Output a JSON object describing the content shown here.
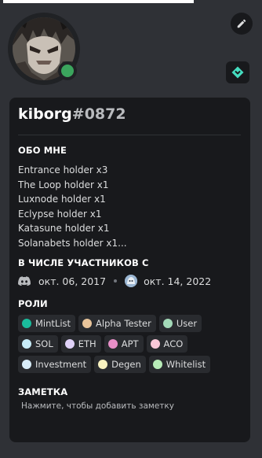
{
  "profile": {
    "username": "kiborg",
    "discriminator": "#0872",
    "status": "online"
  },
  "sections": {
    "about_title": "ОБО МНЕ",
    "member_since_title": "В ЧИСЛЕ УЧАСТНИКОВ С",
    "roles_title": "РОЛИ",
    "note_title": "ЗАМЕТКА"
  },
  "about": {
    "lines": [
      "Entrance holder x3",
      "The Loop holder x1",
      "Luxnode holder x1",
      "Eclypse holder x1",
      "Katasune holder x1",
      "Solanabets holder x1..."
    ]
  },
  "member_since": {
    "discord_date": "окт. 06, 2017",
    "server_date": "окт. 14, 2022"
  },
  "roles": [
    {
      "name": "MintList",
      "color": "#1abc9c"
    },
    {
      "name": "Alpha Tester",
      "color": "#e8c49a"
    },
    {
      "name": "User",
      "color": "#a3d9b8"
    },
    {
      "name": "SOL",
      "color": "#c8ecf8"
    },
    {
      "name": "ETH",
      "color": "#e0d2f8"
    },
    {
      "name": "APT",
      "color": "#e88fc8"
    },
    {
      "name": "ACO",
      "color": "#f8c8d8"
    },
    {
      "name": "Investment",
      "color": "#d8ecf8"
    },
    {
      "name": "Degen",
      "color": "#f8f2c0"
    },
    {
      "name": "Whitelist",
      "color": "#b8ecb8"
    }
  ],
  "note": {
    "placeholder": "Нажмите, чтобы добавить заметку"
  },
  "icons": {
    "edit": "pencil-icon",
    "badge": "hypesquad-badge-icon",
    "discord": "discord-logo-icon",
    "server": "server-icon"
  },
  "colors": {
    "background": "#2f3136",
    "card": "#18191c",
    "online": "#3ba55d",
    "badge_accent": "#45ddc0"
  }
}
